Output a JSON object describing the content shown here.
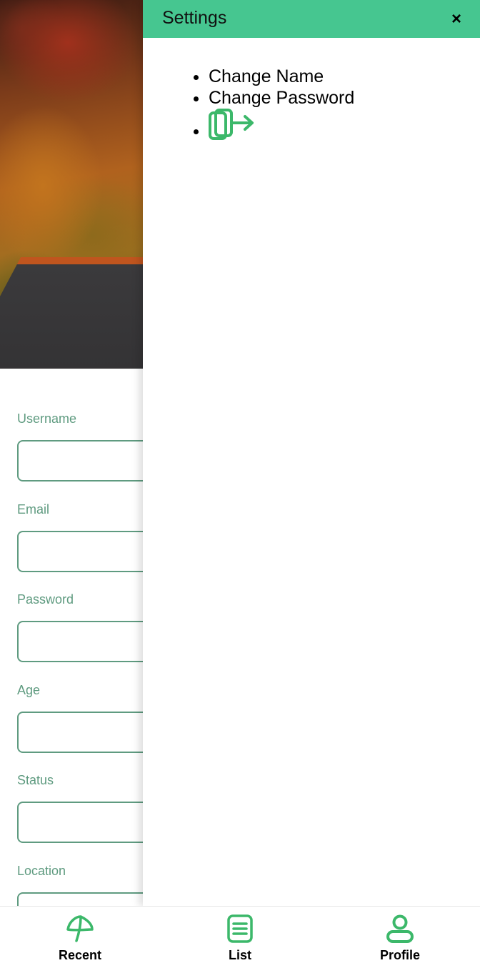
{
  "settings": {
    "title": "Settings",
    "close_label": "×",
    "items": [
      {
        "label": "Change Name"
      },
      {
        "label": "Change Password"
      }
    ],
    "logout_icon": "logout-icon"
  },
  "form": {
    "fields": [
      {
        "label": "Username",
        "value": ""
      },
      {
        "label": "Email",
        "value": ""
      },
      {
        "label": "Password",
        "value": ""
      },
      {
        "label": "Age",
        "value": ""
      },
      {
        "label": "Status",
        "value": ""
      },
      {
        "label": "Location",
        "value": ""
      }
    ]
  },
  "bottom_nav": {
    "items": [
      {
        "label": "Recent",
        "icon": "leaf-icon"
      },
      {
        "label": "List",
        "icon": "list-icon"
      },
      {
        "label": "Profile",
        "icon": "profile-icon"
      }
    ]
  },
  "colors": {
    "accent": "#46c690",
    "label": "#5f9b80",
    "icon": "#3cb86a"
  }
}
